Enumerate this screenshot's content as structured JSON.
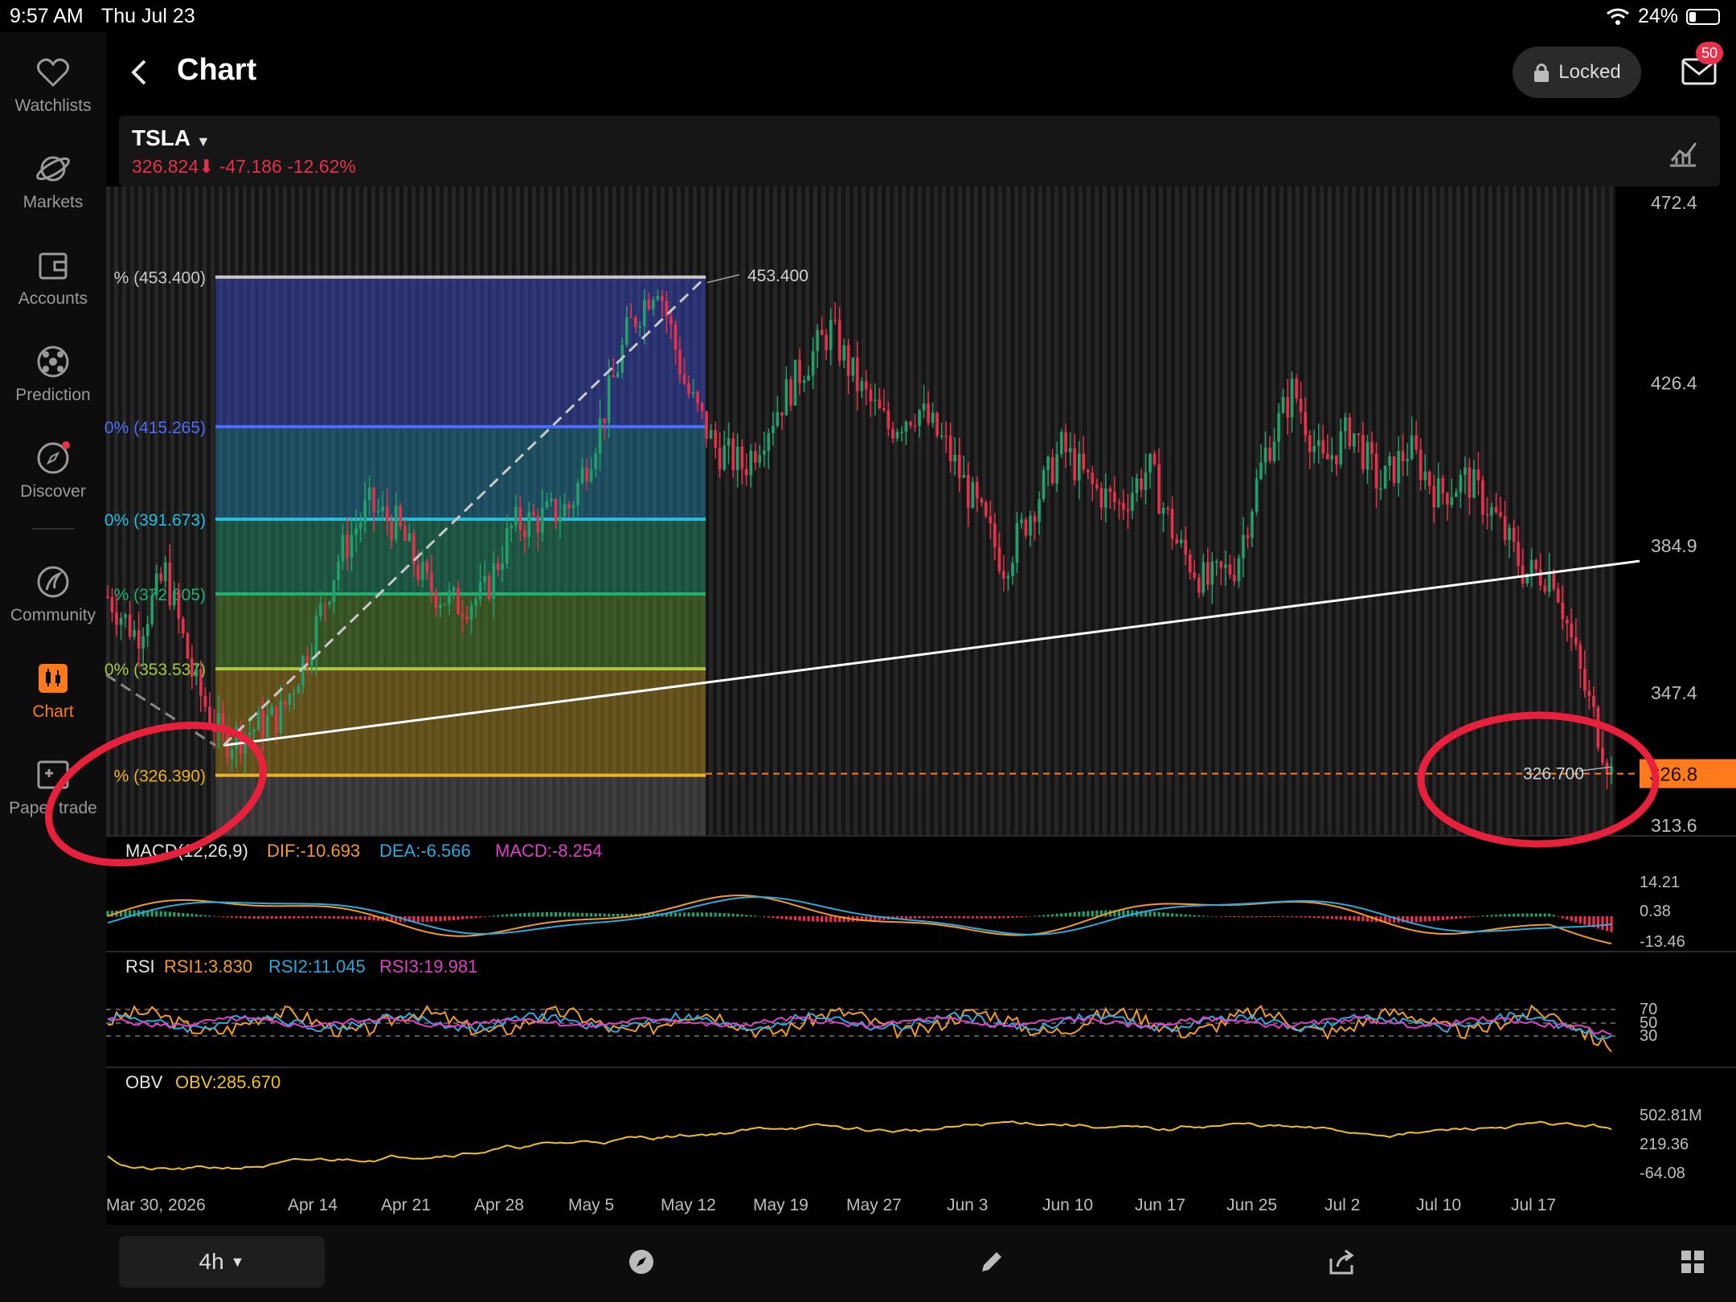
{
  "status_bar": {
    "time": "9:57 AM",
    "date": "Thu Jul 23",
    "battery": "24%"
  },
  "nav": {
    "items": [
      {
        "label": "Watchlists",
        "icon": "heart-icon"
      },
      {
        "label": "Markets",
        "icon": "planet-icon"
      },
      {
        "label": "Accounts",
        "icon": "wallet-icon"
      },
      {
        "label": "Prediction",
        "icon": "ball-icon"
      },
      {
        "label": "Discover",
        "icon": "compass-icon"
      },
      {
        "label": "Community",
        "icon": "community-icon"
      },
      {
        "label": "Chart",
        "icon": "candlestick-icon"
      },
      {
        "label": "Paper trade",
        "icon": "paper-trade-icon"
      }
    ],
    "active": "Chart"
  },
  "header": {
    "title": "Chart",
    "locked_label": "Locked",
    "mail_badge": "50"
  },
  "ticker": {
    "symbol": "TSLA",
    "price": "326.824",
    "change": "-47.186",
    "change_pct": "-12.62%"
  },
  "colors": {
    "up": "#22a06b",
    "down": "#e8304a",
    "accent": "#ff7a1a",
    "dif": "#f39a2b",
    "dea": "#2fa8e0",
    "macd": "#e040c8",
    "obv": "#f0c020"
  },
  "chart_data": [
    {
      "type": "candlestick",
      "title": "TSLA 4h",
      "x_tick_labels": [
        "Mar 30, 2026",
        "Apr 14",
        "Apr 21",
        "Apr 28",
        "May 5",
        "May 12",
        "May 19",
        "May 27",
        "Jun 3",
        "Jun 10",
        "Jun 17",
        "Jun 25",
        "Jul 2",
        "Jul 10",
        "Jul 17"
      ],
      "y_tick_labels": [
        "472.4",
        "426.4",
        "384.9",
        "347.4",
        "313.6"
      ],
      "ylim": [
        310,
        475
      ],
      "current_price": "326.8",
      "high_label": "453.400",
      "low_label": "326.700",
      "fib_levels": [
        {
          "label": "% (453.400)",
          "value": 453.4,
          "color": "#c8c8c8"
        },
        {
          "label": "0% (415.265)",
          "value": 415.265,
          "color": "#4d6bff"
        },
        {
          "label": "0% (391.673)",
          "value": 391.673,
          "color": "#22c0e0"
        },
        {
          "label": "% (372.605)",
          "value": 372.605,
          "color": "#20b070"
        },
        {
          "label": "0% (353.537)",
          "value": 353.537,
          "color": "#a8c840"
        },
        {
          "label": "% (326.390)",
          "value": 326.39,
          "color": "#f0b020"
        }
      ],
      "close_path": [
        [
          "Mar 30",
          372
        ],
        [
          "Apr 2",
          362
        ],
        [
          "Apr 5",
          378
        ],
        [
          "Apr 8",
          350
        ],
        [
          "Apr 10",
          335
        ],
        [
          "Apr 12",
          338
        ],
        [
          "Apr 14",
          342
        ],
        [
          "Apr 16",
          360
        ],
        [
          "Apr 18",
          382
        ],
        [
          "Apr 21",
          395
        ],
        [
          "Apr 23",
          390
        ],
        [
          "Apr 25",
          375
        ],
        [
          "Apr 28",
          370
        ],
        [
          "Apr 30",
          372
        ],
        [
          "May 2",
          390
        ],
        [
          "May 5",
          392
        ],
        [
          "May 7",
          395
        ],
        [
          "May 9",
          415
        ],
        [
          "May 11",
          440
        ],
        [
          "May 13",
          453
        ],
        [
          "May 15",
          425
        ],
        [
          "May 17",
          410
        ],
        [
          "May 19",
          405
        ],
        [
          "May 21",
          418
        ],
        [
          "May 24",
          430
        ],
        [
          "May 27",
          440
        ],
        [
          "May 29",
          425
        ],
        [
          "Jun 1",
          415
        ],
        [
          "Jun 3",
          420
        ],
        [
          "Jun 5",
          410
        ],
        [
          "Jun 8",
          395
        ],
        [
          "Jun 10",
          380
        ],
        [
          "Jun 12",
          395
        ],
        [
          "Jun 15",
          410
        ],
        [
          "Jun 17",
          400
        ],
        [
          "Jun 19",
          395
        ],
        [
          "Jun 21",
          405
        ],
        [
          "Jun 23",
          385
        ],
        [
          "Jun 25",
          375
        ],
        [
          "Jun 27",
          380
        ],
        [
          "Jun 29",
          408
        ],
        [
          "Jul 2",
          425
        ],
        [
          "Jul 4",
          405
        ],
        [
          "Jul 6",
          415
        ],
        [
          "Jul 8",
          400
        ],
        [
          "Jul 10",
          410
        ],
        [
          "Jul 12",
          398
        ],
        [
          "Jul 14",
          402
        ],
        [
          "Jul 16",
          392
        ],
        [
          "Jul 18",
          378
        ],
        [
          "Jul 20",
          378
        ],
        [
          "Jul 21",
          350
        ],
        [
          "Jul 22",
          327
        ]
      ]
    },
    {
      "type": "line",
      "title": "MACD(12,26,9)",
      "series": [
        {
          "name": "DIF",
          "value_label": "DIF:-10.693"
        },
        {
          "name": "DEA",
          "value_label": "DEA:-6.566"
        },
        {
          "name": "MACD",
          "value_label": "MACD:-8.254"
        }
      ],
      "y_tick_labels": [
        "14.21",
        "0.38",
        "-13.46"
      ]
    },
    {
      "type": "line",
      "title": "RSI",
      "series": [
        {
          "name": "RSI1",
          "value_label": "RSI1:3.830"
        },
        {
          "name": "RSI2",
          "value_label": "RSI2:11.045"
        },
        {
          "name": "RSI3",
          "value_label": "RSI3:19.981"
        }
      ],
      "y_tick_labels": [
        "70",
        "50",
        "30"
      ]
    },
    {
      "type": "line",
      "title": "OBV",
      "series": [
        {
          "name": "OBV",
          "value_label": "OBV:285.670"
        }
      ],
      "y_tick_labels": [
        "502.81M",
        "219.36",
        "-64.08"
      ]
    }
  ],
  "toolbar": {
    "interval": "4h"
  }
}
